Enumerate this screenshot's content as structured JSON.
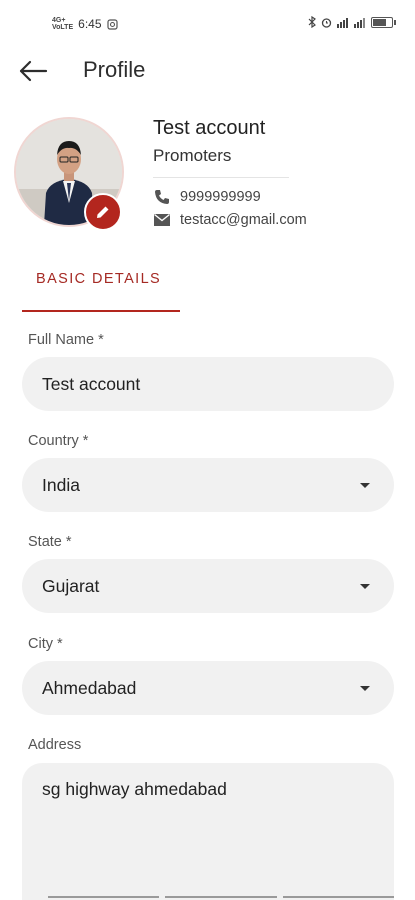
{
  "status_bar": {
    "time": "6:45",
    "network_left": "4G+\nVoLTE",
    "icons_right": [
      "bluetooth-icon",
      "alarm-icon",
      "signal-icon",
      "signal-icon",
      "battery-icon"
    ]
  },
  "header": {
    "title": "Profile",
    "back_icon": "arrow-left-icon"
  },
  "profile": {
    "name": "Test account",
    "role": "Promoters",
    "phone": "9999999999",
    "email": "testacc@gmail.com",
    "edit_icon": "pencil-icon",
    "accent_color": "#b3261e"
  },
  "tabs": [
    {
      "label": "BASIC DETAILS",
      "active": true
    }
  ],
  "form": {
    "full_name": {
      "label": "Full Name *",
      "value": "Test account"
    },
    "country": {
      "label": "Country *",
      "value": "India"
    },
    "state": {
      "label": "State *",
      "value": "Gujarat"
    },
    "city": {
      "label": "City *",
      "value": "Ahmedabad"
    },
    "address": {
      "label": "Address",
      "value": "sg highway ahmedabad"
    }
  }
}
